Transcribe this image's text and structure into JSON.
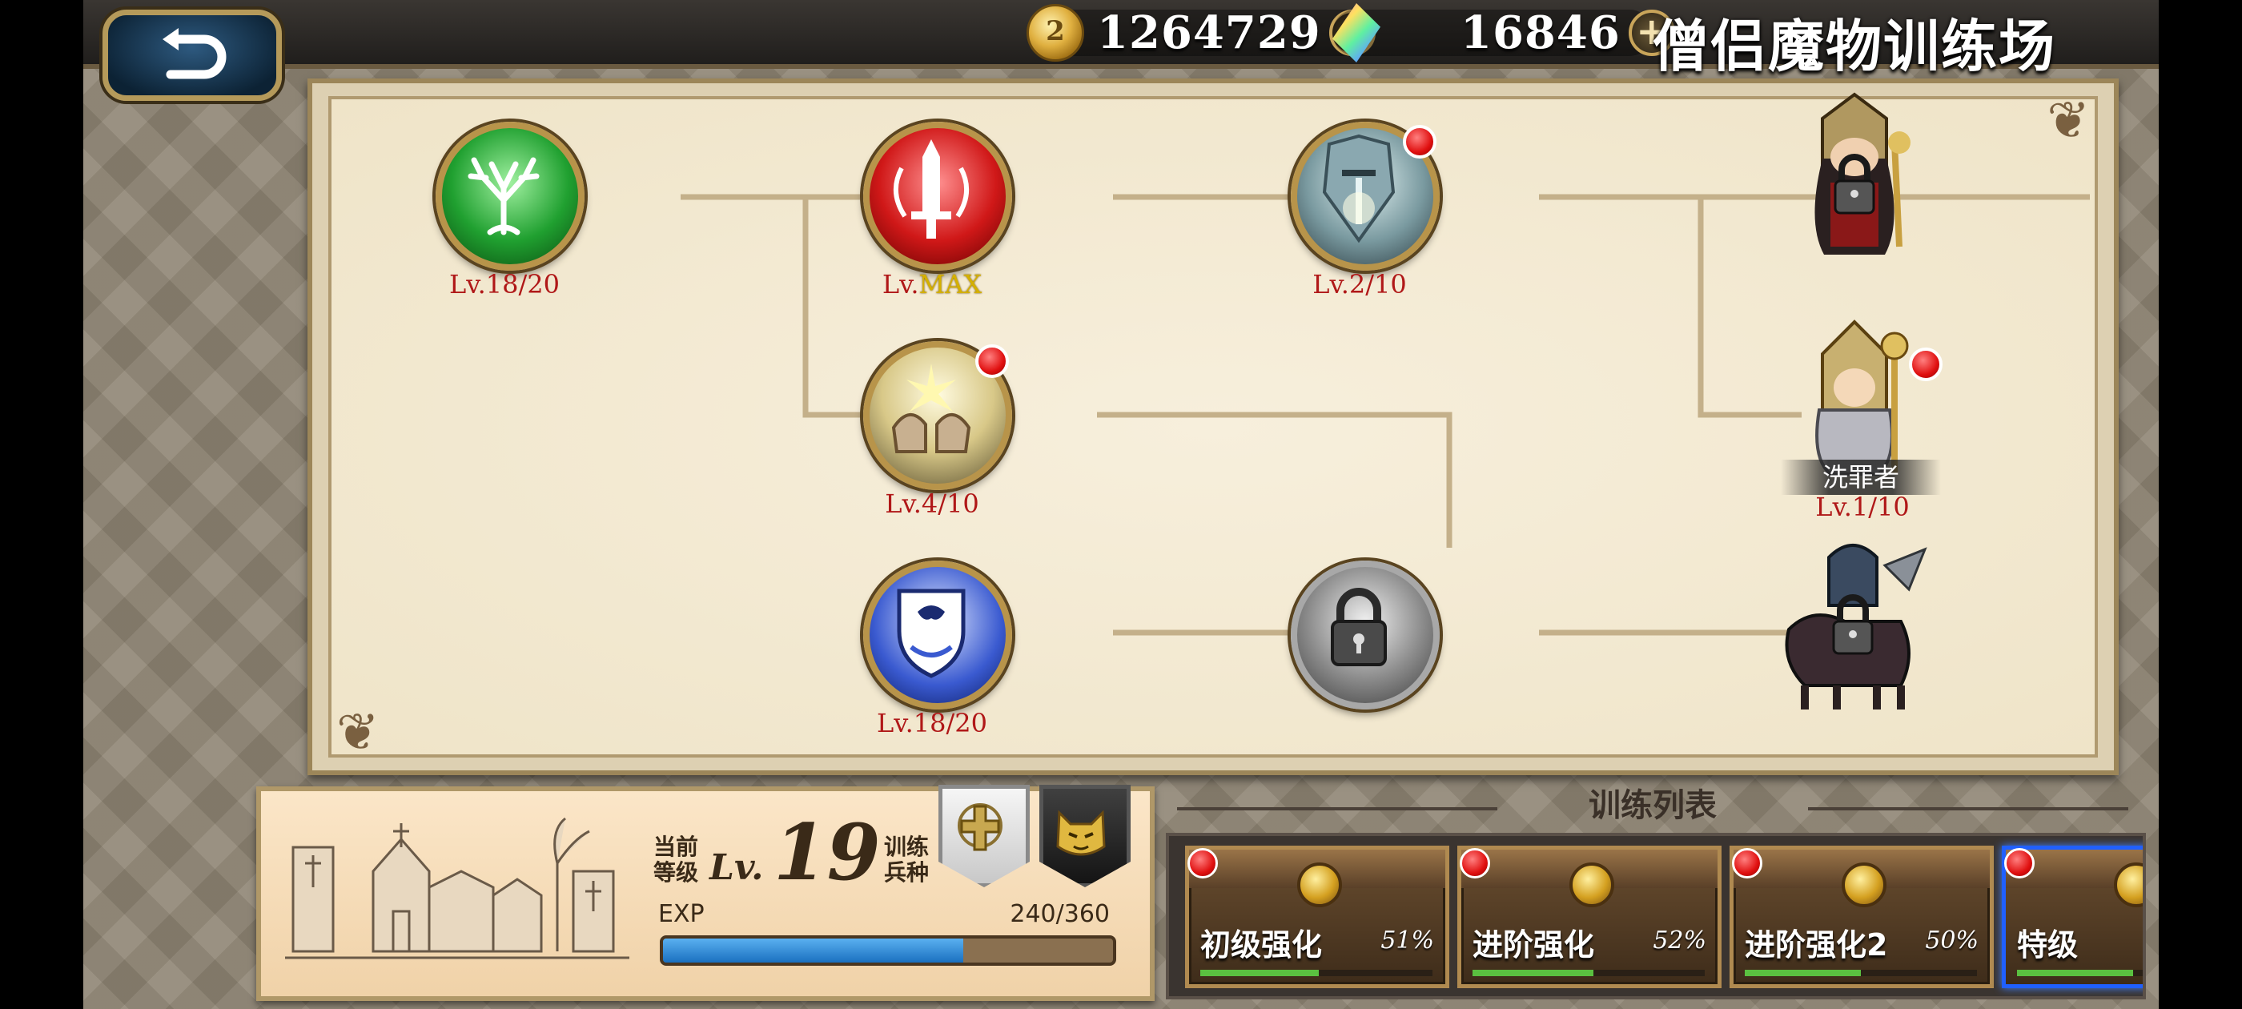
{
  "topbar": {
    "gold": "1264729",
    "coin_symbol": "2",
    "gems": "16846",
    "plus_symbol": "+",
    "title": "僧侣魔物训练场"
  },
  "skills": [
    {
      "id": "tree",
      "level": "Lv.18/20",
      "badge": false
    },
    {
      "id": "sword",
      "level_prefix": "Lv.",
      "level_max": "MAX",
      "badge": false
    },
    {
      "id": "warrior",
      "level": "Lv.2/10",
      "badge": true
    },
    {
      "id": "hands",
      "level": "Lv.4/10",
      "badge": true
    },
    {
      "id": "shield",
      "level": "Lv.18/20",
      "badge": false
    },
    {
      "id": "locked",
      "locked": true
    }
  ],
  "units": {
    "top": {
      "locked": true
    },
    "middle": {
      "name": "洗罪者",
      "level": "Lv.1/10",
      "badge": true
    },
    "bottom": {
      "locked": true
    }
  },
  "info": {
    "current_level_label": "当前等级",
    "level_prefix": "Lv.",
    "level": "19",
    "train_unit_label": "训练兵种",
    "exp_label": "EXP",
    "exp_value": "240/360",
    "exp_progress": 0.667
  },
  "training_list": {
    "title": "训练列表",
    "cards": [
      {
        "name": "初级强化",
        "percent": "51%",
        "progress": 0.51
      },
      {
        "name": "进阶强化",
        "percent": "52%",
        "progress": 0.52
      },
      {
        "name": "进阶强化2",
        "percent": "50%",
        "progress": 0.5
      },
      {
        "name": "特级",
        "percent": "",
        "progress": 0.5
      }
    ]
  },
  "colors": {
    "level_text": "#b01818",
    "max_text": "#d4b000",
    "exp_fill": "#1a70c0",
    "notification_dot": "#e01010"
  }
}
